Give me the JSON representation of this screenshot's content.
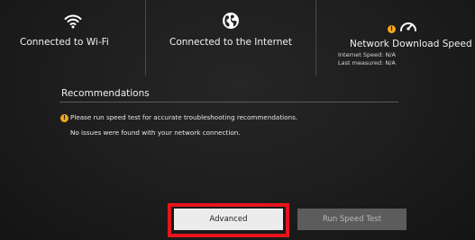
{
  "status": {
    "wifi": {
      "icon": "wifi-icon",
      "label": "Connected to Wi-Fi"
    },
    "internet": {
      "icon": "globe-icon",
      "label": "Connected to the Internet"
    },
    "speed": {
      "icon": "speedometer-icon",
      "warning_icon": "warning-icon",
      "warning_glyph": "!",
      "label": "Network Download Speed",
      "internet_speed": "Internet Speed: N/A",
      "last_measured": "Last measured: N/A"
    }
  },
  "recommendations": {
    "title": "Recommendations",
    "items": [
      {
        "icon": "warning-icon",
        "warning_glyph": "!",
        "text": "Please run speed test for accurate troubleshooting recommendations."
      },
      {
        "text": "No issues were found with your network connection."
      }
    ]
  },
  "buttons": {
    "advanced": "Advanced",
    "run_speed_test": "Run Speed Test"
  },
  "colors": {
    "background": "#1d1d1d",
    "warning": "#f4a51c",
    "focus_highlight": "#e8141c",
    "primary_button": "#ececec",
    "secondary_button": "#5c5c5c"
  }
}
